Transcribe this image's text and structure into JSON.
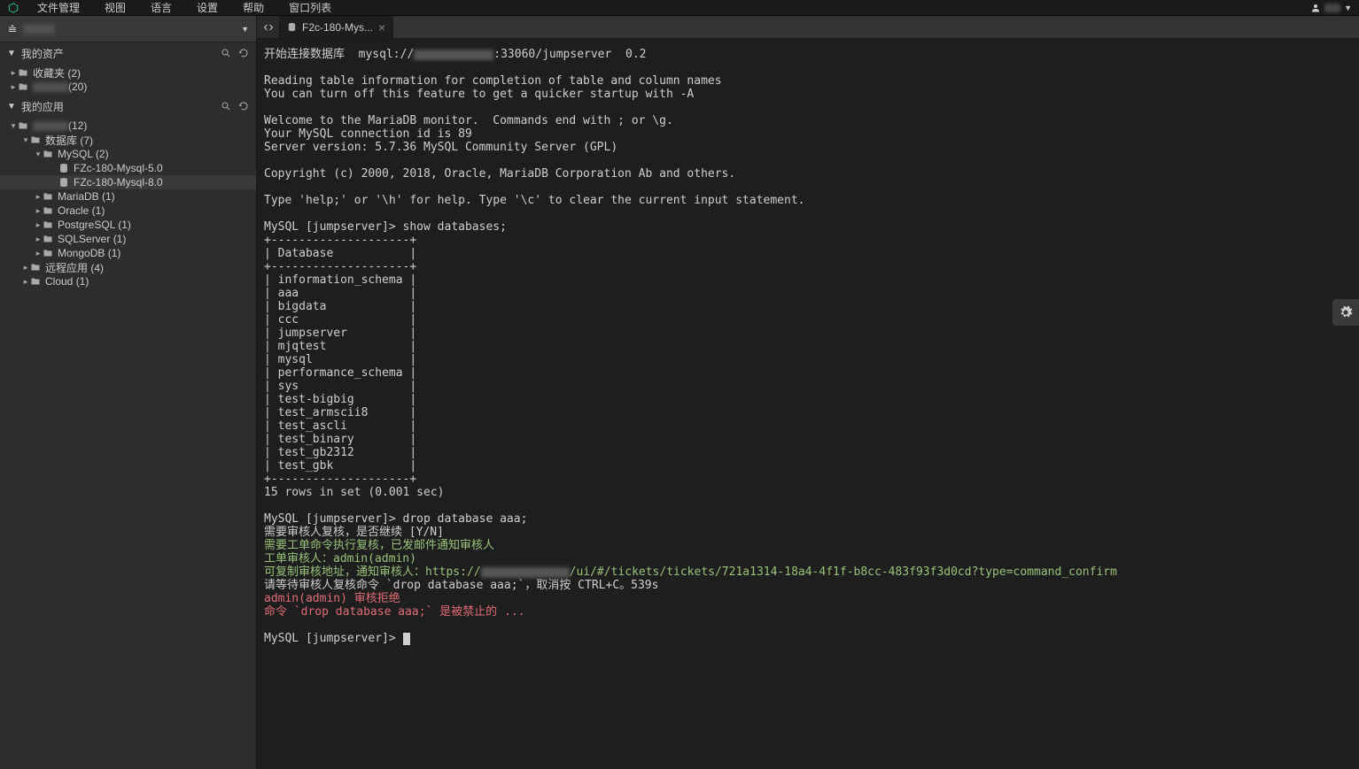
{
  "menu": {
    "items": [
      "文件管理",
      "视图",
      "语言",
      "设置",
      "帮助",
      "窗口列表"
    ]
  },
  "sidebar": {
    "assets_title": "我的资产",
    "apps_title": "我的应用",
    "favorites": "收藏夹 (2)",
    "fav_child_suffix": "(20)",
    "root_suffix": "(12)",
    "database": "数据库 (7)",
    "mysql": "MySQL (2)",
    "mysql_children": [
      "FZc-180-Mysql-5.0",
      "FZc-180-Mysql-8.0"
    ],
    "mariadb": "MariaDB (1)",
    "oracle": "Oracle (1)",
    "postgresql": "PostgreSQL (1)",
    "sqlserver": "SQLServer (1)",
    "mongodb": "MongoDB (1)",
    "remote": "远程应用 (4)",
    "cloud": "Cloud (1)"
  },
  "tab": {
    "title": "F2c-180-Mys..."
  },
  "terminal": {
    "l1a": "开始连接数据库  mysql://",
    "l1b": ":33060/jumpserver  0.2",
    "l2": "Reading table information for completion of table and column names",
    "l3": "You can turn off this feature to get a quicker startup with -A",
    "l4": "Welcome to the MariaDB monitor.  Commands end with ; or \\g.",
    "l5": "Your MySQL connection id is 89",
    "l6": "Server version: 5.7.36 MySQL Community Server (GPL)",
    "l7": "Copyright (c) 2000, 2018, Oracle, MariaDB Corporation Ab and others.",
    "l8": "Type 'help;' or '\\h' for help. Type '\\c' to clear the current input statement.",
    "l9": "MySQL [jumpserver]> show databases;",
    "sep": "+--------------------+",
    "hdr": "| Database           |",
    "rows": [
      "| information_schema |",
      "| aaa                |",
      "| bigdata            |",
      "| ccc                |",
      "| jumpserver         |",
      "| mjqtest            |",
      "| mysql              |",
      "| performance_schema |",
      "| sys                |",
      "| test-bigbig        |",
      "| test_armscii8      |",
      "| test_ascli         |",
      "| test_binary        |",
      "| test_gb2312        |",
      "| test_gbk           |"
    ],
    "summary": "15 rows in set (0.001 sec)",
    "drop": "MySQL [jumpserver]> drop database aaa;",
    "confirm": "需要审核人复核，是否继续 [Y/N]",
    "g1": "需要工单命令执行复核，已发邮件通知审核人",
    "g2": "工单审核人：admin(admin)",
    "g3a": "可复制审核地址，通知审核人：https://",
    "g3b": "/ui/#/tickets/tickets/721a1314-18a4-4f1f-b8cc-483f93f3d0cd?type=command_confirm",
    "wait": "请等待审核人复核命令 `drop database aaa;`，取消按 CTRL+C。539s",
    "r1": "admin(admin) 审核拒绝",
    "r2": "命令 `drop database aaa;` 是被禁止的 ...",
    "prompt": "MySQL [jumpserver]> "
  }
}
